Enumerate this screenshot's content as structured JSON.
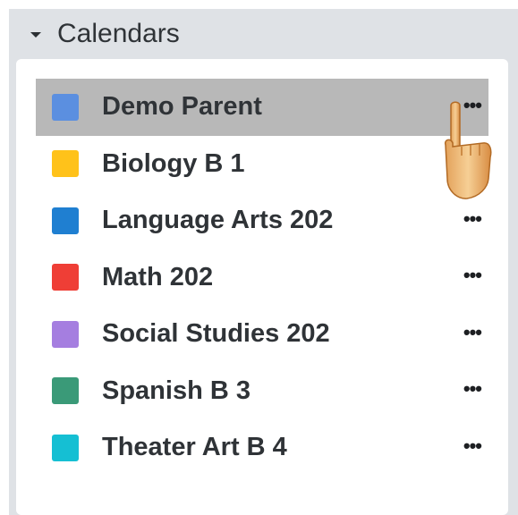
{
  "panel": {
    "title": "Calendars",
    "caret_icon": "caret-down-icon"
  },
  "calendars": [
    {
      "label": "Demo Parent",
      "color": "#5b8fe0",
      "more": "•••",
      "selected": true
    },
    {
      "label": "Biology B 1",
      "color": "#ffc21a",
      "more": "",
      "selected": false
    },
    {
      "label": "Language Arts 202",
      "color": "#1f7fd1",
      "more": "•••",
      "selected": false
    },
    {
      "label": "Math 202",
      "color": "#ef3e36",
      "more": "•••",
      "selected": false
    },
    {
      "label": "Social Studies 202",
      "color": "#a57ee0",
      "more": "•••",
      "selected": false
    },
    {
      "label": "Spanish B 3",
      "color": "#3a9a78",
      "more": "•••",
      "selected": false
    },
    {
      "label": "Theater Art B 4",
      "color": "#15bfd3",
      "more": "•••",
      "selected": false
    }
  ],
  "cursor": {
    "icon": "hand-pointer-icon"
  },
  "colors": {
    "panel_bg": "#dfe2e6",
    "selected_row": "#b8b8b8",
    "text": "#2f3337"
  }
}
